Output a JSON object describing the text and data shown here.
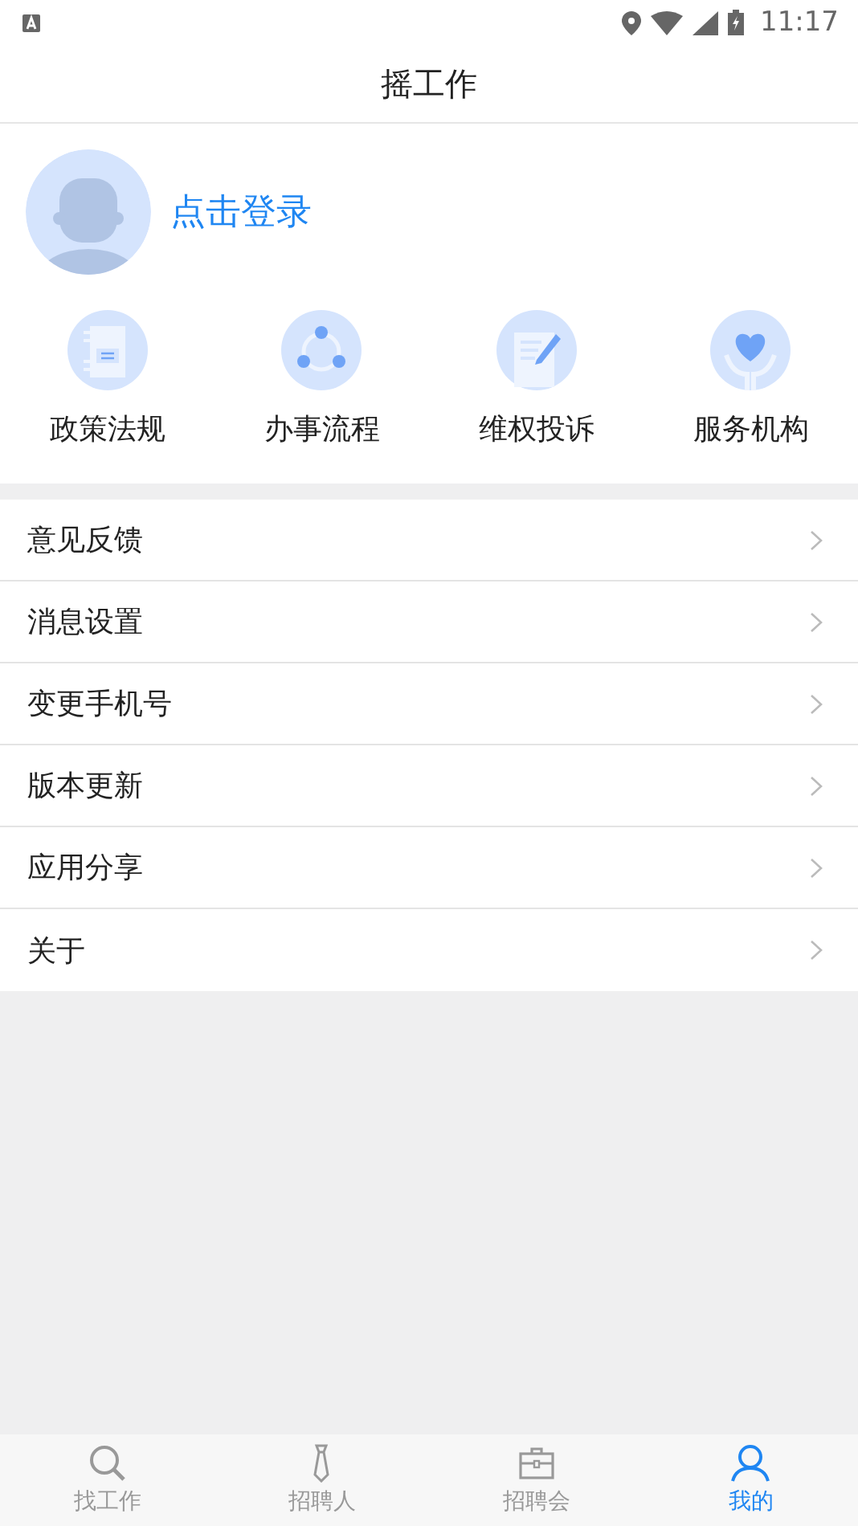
{
  "status_bar": {
    "time": "11:17"
  },
  "header": {
    "title": "摇工作"
  },
  "profile": {
    "login": "点击登录"
  },
  "shortcuts": [
    {
      "label": "政策法规",
      "kind": "notebook"
    },
    {
      "label": "办事流程",
      "kind": "cycle"
    },
    {
      "label": "维权投诉",
      "kind": "edit"
    },
    {
      "label": "服务机构",
      "kind": "heart"
    }
  ],
  "menu": [
    {
      "label": "意见反馈"
    },
    {
      "label": "消息设置"
    },
    {
      "label": "变更手机号"
    },
    {
      "label": "版本更新"
    },
    {
      "label": "应用分享"
    },
    {
      "label": "关于"
    }
  ],
  "tabs": [
    {
      "label": "找工作",
      "kind": "search",
      "selected": false
    },
    {
      "label": "招聘人",
      "kind": "tie",
      "selected": false
    },
    {
      "label": "招聘会",
      "kind": "briefcase",
      "selected": false
    },
    {
      "label": "我的",
      "kind": "person",
      "selected": true
    }
  ]
}
